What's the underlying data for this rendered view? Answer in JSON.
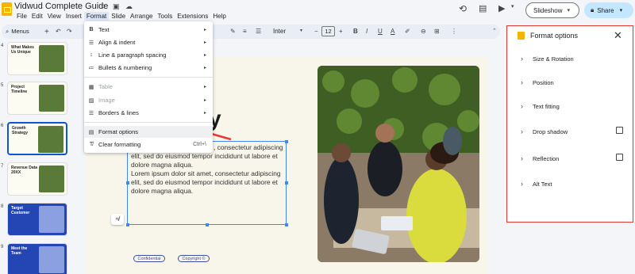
{
  "app": {
    "title": "Vidwud Complete Guide",
    "title_icons": [
      "star-icon",
      "move-to-folder-icon",
      "cloud-saved-icon"
    ]
  },
  "menubar": [
    "File",
    "Edit",
    "View",
    "Insert",
    "Format",
    "Slide",
    "Arrange",
    "Tools",
    "Extensions",
    "Help"
  ],
  "menubar_active": "Format",
  "header_actions": {
    "slideshow_label": "Slideshow",
    "share_label": "Share"
  },
  "toolbar": {
    "menus_label": "Menus",
    "font_name": "Inter",
    "font_size": "12",
    "format_buttons": [
      "B",
      "I",
      "U",
      "A"
    ]
  },
  "slides": [
    {
      "number": "4",
      "title": "What Makes Us Unique",
      "theme": "light"
    },
    {
      "number": "5",
      "title": "Project Timeline",
      "theme": "light"
    },
    {
      "number": "6",
      "title": "Growth Strategy",
      "theme": "light",
      "selected": true
    },
    {
      "number": "7",
      "title": "Revenue Data 20XX",
      "theme": "light"
    },
    {
      "number": "8",
      "title": "Target Customer",
      "theme": "blue"
    },
    {
      "number": "9",
      "title": "Meet the Team",
      "theme": "blue"
    }
  ],
  "slide_canvas": {
    "heading_fragment": "y",
    "body_lines": [
      ", consectetur adipiscing",
      "elit, sed do eiusmod tempor incididunt ut labore et",
      "dolore magna aliqua.",
      "Lorem ipsum dolor sit amet, consectetur adipiscing",
      "elit, sed do eiusmod tempor incididunt ut labore et",
      "dolore magna aliqua."
    ],
    "pills": [
      "Confidential",
      "Copyright ©"
    ]
  },
  "format_menu": {
    "items": [
      {
        "label": "Text",
        "icon": "bold-icon",
        "submenu": true,
        "disabled": false
      },
      {
        "label": "Align & indent",
        "icon": "align-icon",
        "submenu": true,
        "disabled": false
      },
      {
        "label": "Line & paragraph spacing",
        "icon": "line-spacing-icon",
        "submenu": true,
        "disabled": false
      },
      {
        "label": "Bullets & numbering",
        "icon": "bullets-icon",
        "submenu": true,
        "disabled": false
      },
      {
        "label": "Table",
        "icon": "table-icon",
        "submenu": true,
        "disabled": true
      },
      {
        "label": "Image",
        "icon": "image-icon",
        "submenu": true,
        "disabled": true
      },
      {
        "label": "Borders & lines",
        "icon": "borders-icon",
        "submenu": true,
        "disabled": false
      },
      {
        "label": "Format options",
        "icon": "format-options-icon",
        "submenu": false,
        "disabled": false,
        "highlighted": true
      },
      {
        "label": "Clear formatting",
        "icon": "clear-formatting-icon",
        "submenu": false,
        "disabled": false,
        "shortcut": "Ctrl+\\"
      }
    ]
  },
  "format_panel": {
    "title": "Format options",
    "sections": [
      {
        "label": "Size & Rotation",
        "has_checkbox": false
      },
      {
        "label": "Position",
        "has_checkbox": false
      },
      {
        "label": "Text fitting",
        "has_checkbox": false
      },
      {
        "label": "Drop shadow",
        "has_checkbox": true,
        "checked": false
      },
      {
        "label": "Reflection",
        "has_checkbox": true,
        "checked": false
      },
      {
        "label": "Alt Text",
        "has_checkbox": false
      }
    ]
  },
  "colors": {
    "accent": "#0b57d0",
    "share_bg": "#c2e7ff",
    "highlight_border": "#e53935",
    "pointer_arrow": "#e53935"
  }
}
